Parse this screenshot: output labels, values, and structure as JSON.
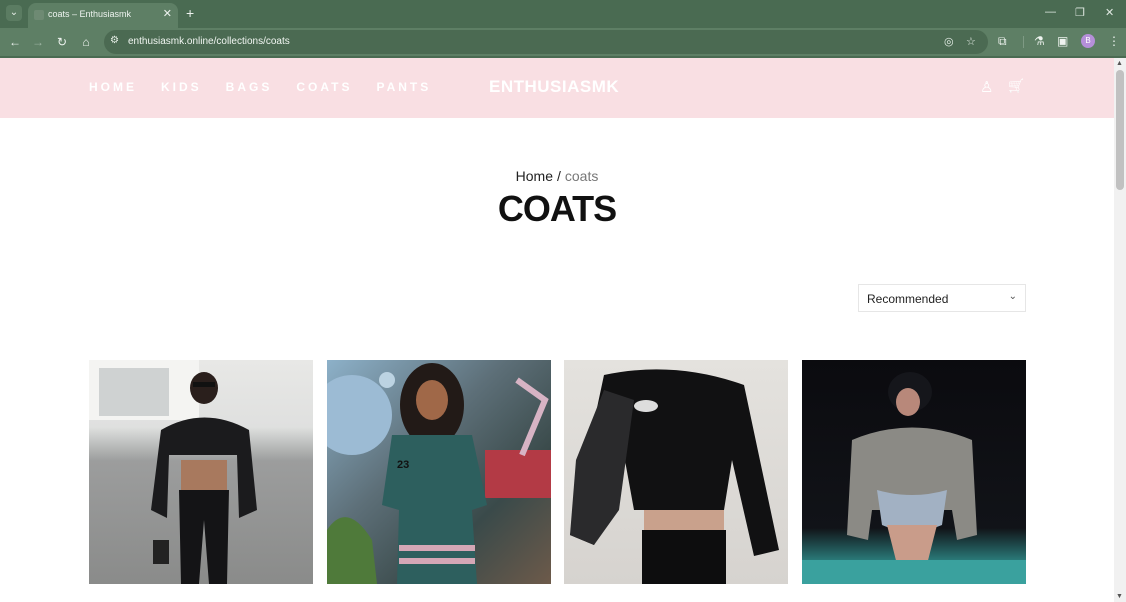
{
  "browser": {
    "tab_title": "coats – Enthusiasmk",
    "tab_close": "✕",
    "new_tab": "+",
    "tab_search": "⌄",
    "url": "enthusiasmk.online/collections/coats",
    "back": "←",
    "forward": "→",
    "reload": "↻",
    "home": "⌂",
    "site_info": "⚙",
    "eye_off": "◎",
    "star": "☆",
    "extensions": "⧉",
    "labs": "⚗",
    "sidebar": "▣",
    "profile_initial": "B",
    "menu": "⋮",
    "minimize": "—",
    "restore": "❐",
    "close": "✕"
  },
  "site": {
    "nav": [
      "HOME",
      "KIDS",
      "BAGS",
      "COATS",
      "PANTS"
    ],
    "logo": "ENTHUSIASMK",
    "account_icon": "♙",
    "cart_icon": "🛒"
  },
  "breadcrumb": {
    "home": "Home",
    "separator": "/",
    "current": "coats"
  },
  "page_title": "COATS",
  "sort": {
    "selected": "Recommended",
    "chevron": "⌄"
  },
  "products": [
    {
      "alt": "Black cropped puffer jacket and leather pants"
    },
    {
      "alt": "Green varsity shirt with number 23"
    },
    {
      "alt": "Black cropped leather-sleeve jacket"
    },
    {
      "alt": "Grey cropped puffer bomber jacket"
    }
  ],
  "colors": {
    "chrome": "#4a6b52",
    "header_bg": "#f9dfe3",
    "title_text": "#111111"
  }
}
